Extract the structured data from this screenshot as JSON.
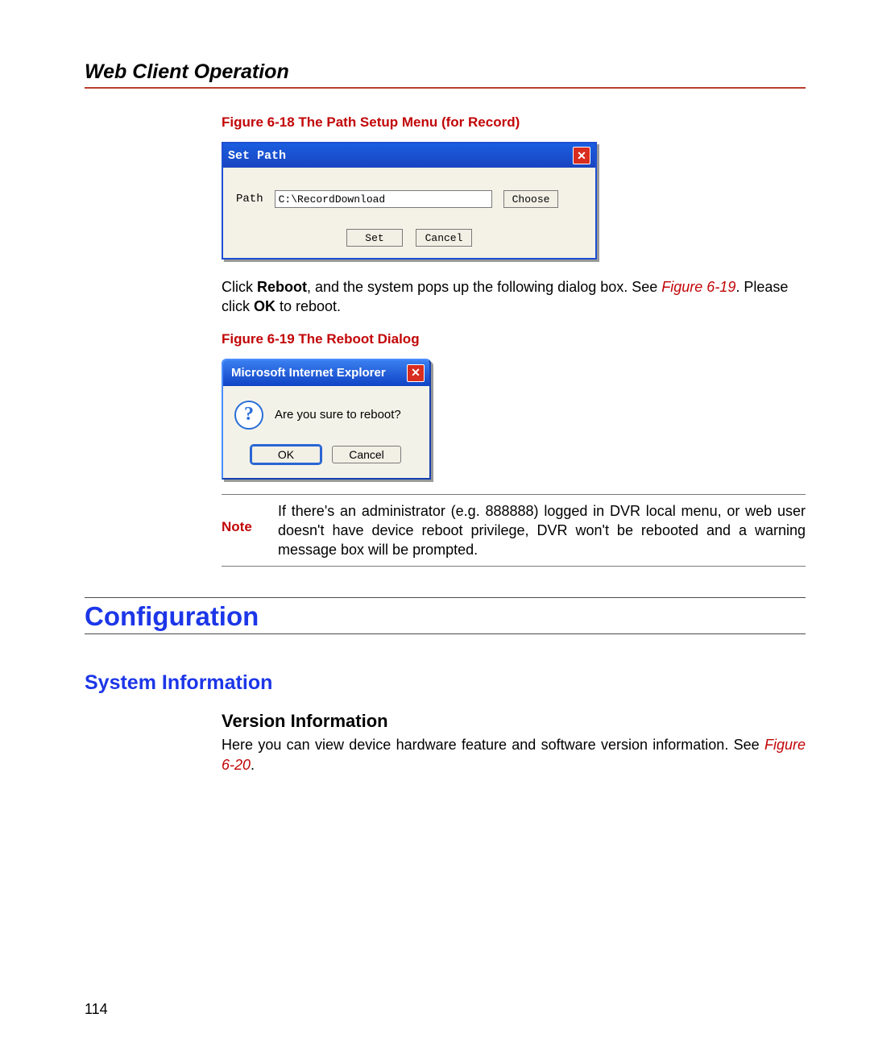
{
  "header_title": "Web Client Operation",
  "fig18_caption": "Figure 6-18 The Path Setup Menu (for Record)",
  "setpath": {
    "title": "Set Path",
    "path_label": "Path",
    "path_value": "C:\\RecordDownload",
    "choose": "Choose",
    "set": "Set",
    "cancel": "Cancel"
  },
  "paragraph1": {
    "pre": "Click ",
    "bold1": "Reboot",
    "mid1": ", and the system pops up the following dialog box. See ",
    "figref": "Figure 6-19",
    "mid2": ". Please click ",
    "bold2": "OK",
    "end": " to reboot."
  },
  "fig19_caption": "Figure 6-19 The Reboot Dialog",
  "reboot": {
    "title": "Microsoft Internet Explorer",
    "message": "Are you sure to reboot?",
    "ok": "OK",
    "cancel": "Cancel"
  },
  "note_label": "Note",
  "note_text": "If there's an administrator (e.g. 888888) logged in DVR local menu, or web user doesn't have device reboot privilege, DVR won't be rebooted and a warning message box will be prompted.",
  "config_heading": "Configuration",
  "sysinfo_heading": "System Information",
  "version_heading": "Version Information",
  "version_text_pre": "Here you can view device hardware feature and software version information. See ",
  "version_figref": "Figure 6-20",
  "version_text_post": ".",
  "page_number": "114"
}
